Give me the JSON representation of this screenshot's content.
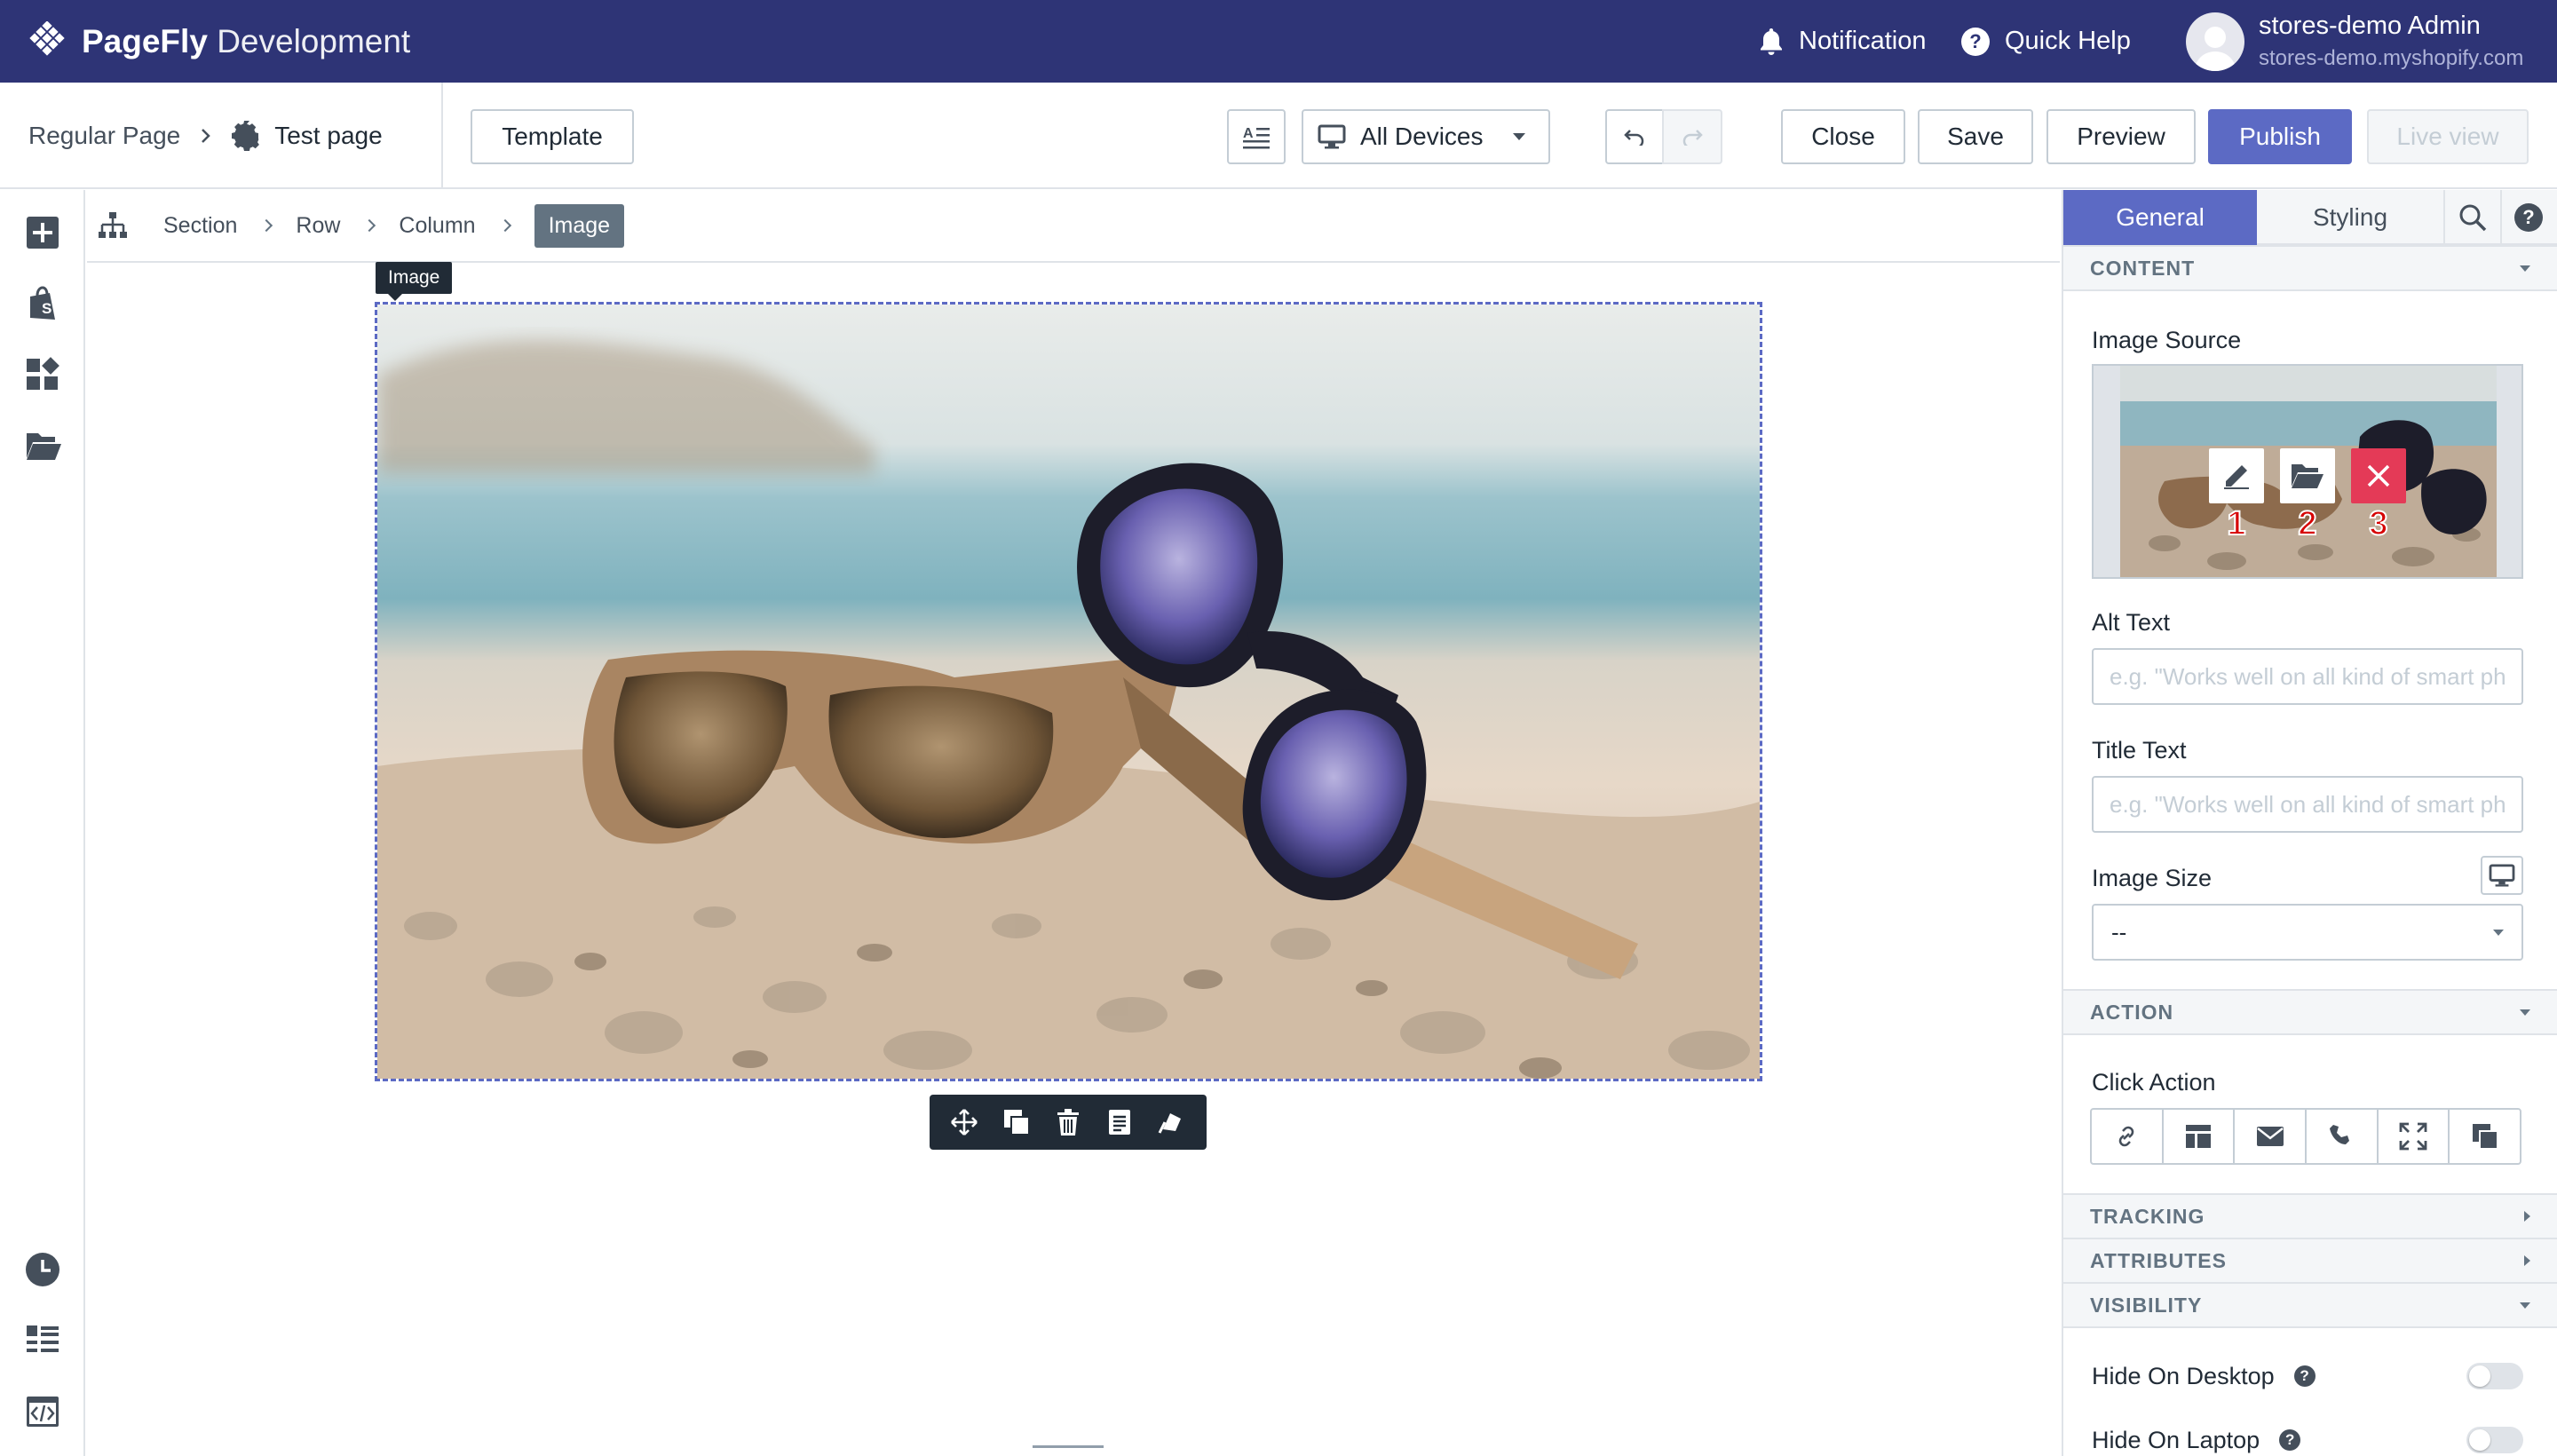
{
  "app": {
    "brand": "PageFly",
    "brand_suffix": "Development",
    "notification": "Notification",
    "quick_help": "Quick Help",
    "user_name": "stores-demo Admin",
    "user_domain": "stores-demo.myshopify.com"
  },
  "toolbar": {
    "page_type": "Regular Page",
    "page_name": "Test page",
    "template": "Template",
    "device": "All Devices",
    "close": "Close",
    "save": "Save",
    "preview": "Preview",
    "publish": "Publish",
    "live_view": "Live view"
  },
  "breadcrumb": [
    "Section",
    "Row",
    "Column",
    "Image"
  ],
  "canvas": {
    "selected_tag": "Image"
  },
  "panel": {
    "tabs": {
      "general": "General",
      "styling": "Styling"
    },
    "sections": {
      "content": "CONTENT",
      "action": "ACTION",
      "tracking": "TRACKING",
      "attributes": "ATTRIBUTES",
      "visibility": "VISIBILITY"
    },
    "image_source_label": "Image Source",
    "image_action_numbers": [
      "1",
      "2",
      "3"
    ],
    "alt_text_label": "Alt Text",
    "alt_text_placeholder": "e.g. \"Works well on all kind of smart phones\"",
    "title_text_label": "Title Text",
    "title_text_placeholder": "e.g. \"Works well on all kind of smart phones\"",
    "image_size_label": "Image Size",
    "image_size_value": "--",
    "click_action_label": "Click Action",
    "hide_desktop": "Hide On Desktop",
    "hide_laptop": "Hide On Laptop",
    "help_glyph": "?"
  },
  "colors": {
    "topbar": "#2e3476",
    "primary": "#5c6ac4",
    "danger": "#e43a57",
    "badge_number": "#d60000"
  }
}
